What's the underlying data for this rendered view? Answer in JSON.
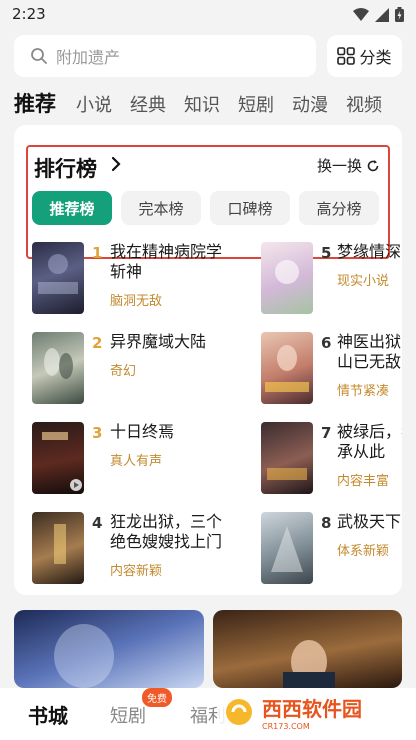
{
  "status": {
    "time": "2:23"
  },
  "search": {
    "placeholder": "附加遗产",
    "category_label": "分类"
  },
  "tabs": [
    "推荐",
    "小说",
    "经典",
    "知识",
    "短剧",
    "动漫",
    "视频"
  ],
  "ranking": {
    "title": "排行榜",
    "refresh_label": "换一换",
    "chips": [
      "推荐榜",
      "完本榜",
      "口碑榜",
      "高分榜"
    ]
  },
  "books": [
    {
      "rank": "1",
      "title": "我在精神病院学斩神",
      "tag": "脑洞无敌"
    },
    {
      "rank": "2",
      "title": "异界魔域大陆",
      "tag": "奇幻"
    },
    {
      "rank": "3",
      "title": "十日终焉",
      "tag": "真人有声"
    },
    {
      "rank": "4",
      "title": "狂龙出狱，三个绝色嫂嫂找上门",
      "tag": "内容新颖"
    },
    {
      "rank": "5",
      "title": "梦缘情深",
      "tag": "现实小说"
    },
    {
      "rank": "6",
      "title": "神医出狱，下山已无敌",
      "tag": "情节紧凑"
    },
    {
      "rank": "7",
      "title": "被绿后，我继承从此",
      "tag": "内容丰富"
    },
    {
      "rank": "8",
      "title": "武极天下",
      "tag": "体系新颖"
    }
  ],
  "nav": {
    "bookstore": "书城",
    "short_drama": "短剧",
    "welfare": "福利",
    "free_badge": "免费"
  },
  "watermark": {
    "main": "西西软件园",
    "sub": "CR173.COM"
  },
  "colors": {
    "accent": "#13a07a",
    "tag": "#c48a2e",
    "highlight": "#d9473b",
    "rank_gold": "#e0a33a",
    "rank_gray": "#333333"
  }
}
